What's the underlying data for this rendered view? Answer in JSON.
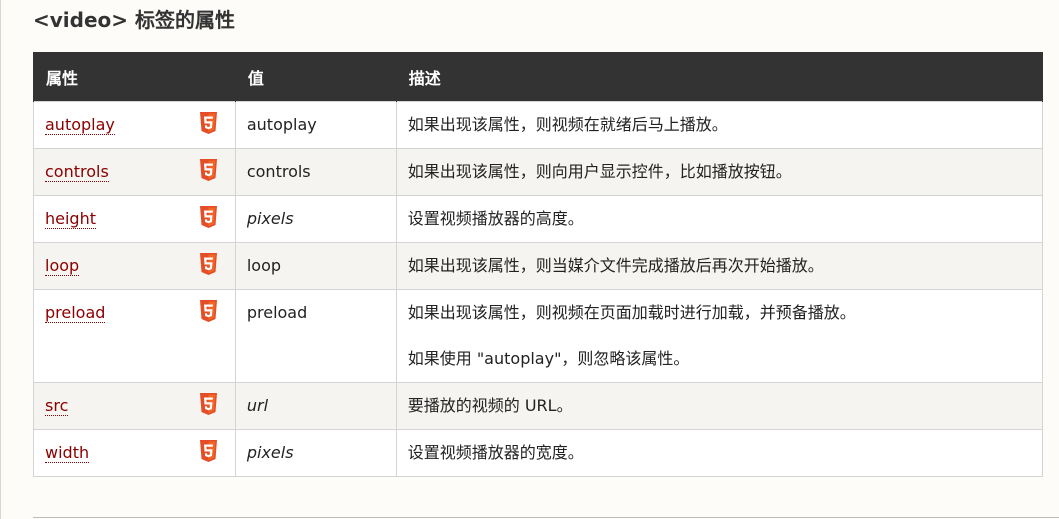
{
  "heading": "<video> 标签的属性",
  "table": {
    "headers": [
      "属性",
      "值",
      "描述"
    ],
    "rows": [
      {
        "attr": "autoplay",
        "value": "autoplay",
        "value_italic": false,
        "desc": "如果出现该属性，则视频在就绪后马上播放。",
        "desc2": ""
      },
      {
        "attr": "controls",
        "value": "controls",
        "value_italic": false,
        "desc": "如果出现该属性，则向用户显示控件，比如播放按钮。",
        "desc2": ""
      },
      {
        "attr": "height",
        "value": "pixels",
        "value_italic": true,
        "desc": "设置视频播放器的高度。",
        "desc2": ""
      },
      {
        "attr": "loop",
        "value": "loop",
        "value_italic": false,
        "desc": "如果出现该属性，则当媒介文件完成播放后再次开始播放。",
        "desc2": ""
      },
      {
        "attr": "preload",
        "value": "preload",
        "value_italic": false,
        "desc": "如果出现该属性，则视频在页面加载时进行加载，并预备播放。",
        "desc2": "如果使用 \"autoplay\"，则忽略该属性。"
      },
      {
        "attr": "src",
        "value": "url",
        "value_italic": true,
        "desc": "要播放的视频的 URL。",
        "desc2": ""
      },
      {
        "attr": "width",
        "value": "pixels",
        "value_italic": true,
        "desc": "设置视频播放器的宽度。",
        "desc2": ""
      }
    ]
  },
  "icon_name": "html5-icon",
  "colors": {
    "header_bg": "#333333",
    "link": "#8b0000",
    "html5_orange": "#e44d26",
    "alt_row": "#f6f4f0"
  }
}
